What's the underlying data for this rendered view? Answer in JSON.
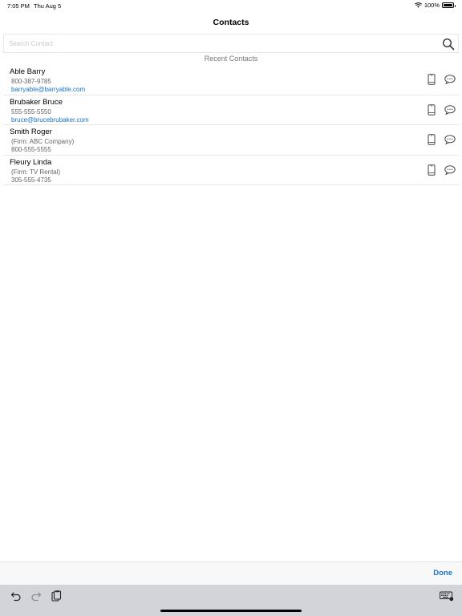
{
  "status_bar": {
    "time": "7:05 PM",
    "date": "Thu Aug 5",
    "battery": "100%"
  },
  "header": {
    "title": "Contacts"
  },
  "search": {
    "placeholder": "Search Contact",
    "value": ""
  },
  "section_title": "Recent Contacts",
  "contacts": [
    {
      "name": "Able Barry",
      "line1": "800-387-9785",
      "line2": "barryable@barryable.com",
      "line2_type": "email"
    },
    {
      "name": "Brubaker Bruce",
      "line1": "555-555-5550",
      "line2": "bruce@brucebrubaker.com",
      "line2_type": "email"
    },
    {
      "name": "Smith Roger",
      "line1": "(Firm: ABC Company)",
      "line2": "800-555-5555",
      "line2_type": "phone"
    },
    {
      "name": "Fleury Linda",
      "line1": "(Firm: TV Rental)",
      "line2": "305-555-4735",
      "line2_type": "phone"
    }
  ],
  "toolbar": {
    "done_label": "Done"
  },
  "icons": {
    "wifi": "wifi-icon",
    "battery": "battery-icon",
    "search": "search-icon",
    "phone": "mobile-phone-icon",
    "message": "message-bubble-icon",
    "undo": "undo-icon",
    "redo": "redo-icon",
    "paste": "paste-icon",
    "keyboard": "keyboard-icon"
  },
  "colors": {
    "accent": "#1a73c9",
    "keyboard_bg": "#d2d4d9"
  }
}
